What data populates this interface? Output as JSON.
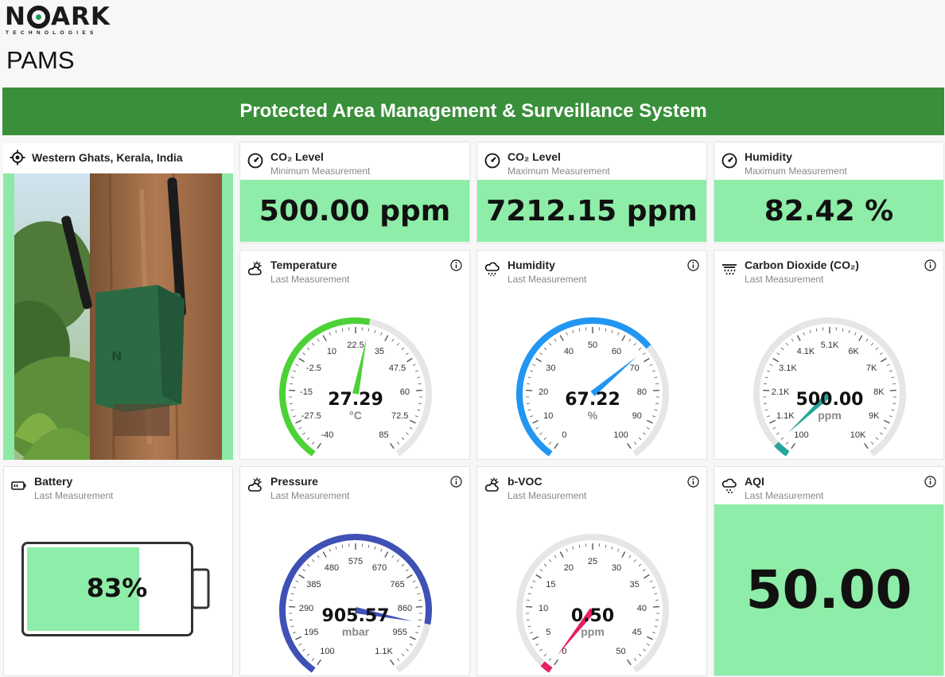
{
  "brand": {
    "name_pre": "N",
    "name_post": "ARK",
    "tagline": "TECHNOLOGIES"
  },
  "app": {
    "title": "PAMS"
  },
  "banner": {
    "text": "Protected Area Management & Surveillance System"
  },
  "location": {
    "label": "Western Ghats, Kerala, India",
    "icon": "target-icon"
  },
  "stats": [
    {
      "title": "CO₂ Level",
      "subtitle": "Minimum Measurement",
      "value": "500.00 ppm",
      "icon": "gauge-icon"
    },
    {
      "title": "CO₂ Level",
      "subtitle": "Maximum Measurement",
      "value": "7212.15 ppm",
      "icon": "gauge-icon"
    },
    {
      "title": "Humidity",
      "subtitle": "Maximum Measurement",
      "value": "82.42 %",
      "icon": "gauge-icon"
    }
  ],
  "gauges": {
    "temperature": {
      "title": "Temperature",
      "subtitle": "Last Measurement",
      "value": "27.29",
      "unit": "°C",
      "raw": 27.29,
      "min": -40,
      "max": 85,
      "ticks": [
        "-40",
        "-27.5",
        "-15",
        "-2.5",
        "10",
        "22.5",
        "35",
        "47.5",
        "60",
        "72.5",
        "85"
      ],
      "color": "#4cd137",
      "needle": "#4cd137",
      "fill_from_start": true
    },
    "humidity": {
      "title": "Humidity",
      "subtitle": "Last Measurement",
      "value": "67.22",
      "unit": "%",
      "raw": 67.22,
      "min": 0,
      "max": 100,
      "ticks": [
        "0",
        "10",
        "20",
        "30",
        "40",
        "50",
        "60",
        "70",
        "80",
        "90",
        "100"
      ],
      "color": "#2196f3",
      "needle": "#2196f3",
      "fill_from_start": true
    },
    "co2": {
      "title": "Carbon Dioxide (CO₂)",
      "subtitle": "Last Measurement",
      "value": "500.00",
      "unit": "ppm",
      "raw": 500,
      "min": 100,
      "max": 10000,
      "ticks": [
        "100",
        "1.1K",
        "2.1K",
        "3.1K",
        "4.1K",
        "5.1K",
        "6K",
        "7K",
        "8K",
        "9K",
        "10K"
      ],
      "color": "#26a69a",
      "needle": "#26a69a",
      "fill_from_start": true
    },
    "pressure": {
      "title": "Pressure",
      "subtitle": "Last Measurement",
      "value": "905.57",
      "unit": "mbar",
      "raw": 905.57,
      "min": 100,
      "max": 1050,
      "ticks": [
        "100",
        "195",
        "290",
        "385",
        "480",
        "575",
        "670",
        "765",
        "860",
        "955",
        "1.1K"
      ],
      "color": "#3f51b5",
      "needle": "#3f51b5",
      "fill_from_start": true
    },
    "bvoc": {
      "title": "b-VOC",
      "subtitle": "Last Measurement",
      "value": "0.50",
      "unit": "ppm",
      "raw": 0.5,
      "min": 0,
      "max": 50,
      "ticks": [
        "0",
        "5",
        "10",
        "15",
        "20",
        "25",
        "30",
        "35",
        "40",
        "45",
        "50"
      ],
      "color": "#e91e63",
      "needle": "#e91e63",
      "fill_from_start": true
    }
  },
  "battery": {
    "title": "Battery",
    "subtitle": "Last Measurement",
    "value": "83%",
    "level": 0.83,
    "icon": "battery-icon"
  },
  "aqi": {
    "title": "AQI",
    "subtitle": "Last Measurement",
    "value": "50.00",
    "icon": "cloud-drizzle-icon"
  },
  "colors": {
    "banner": "#3a8f3a",
    "value_bg": "#8eeda8",
    "track": "#e6e6e6"
  }
}
